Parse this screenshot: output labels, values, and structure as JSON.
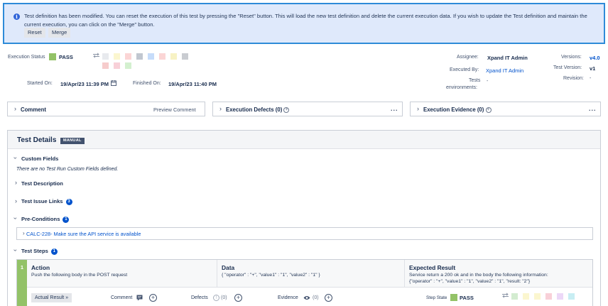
{
  "banner": {
    "message": "Test definition has been modified. You can reset the execution of this test by pressing the \"Reset\" button. This will load the new test definition and delete the current execution data. If you wish to update the Test definition and maintain the current execution, you can click on the \"Merge\" button.",
    "reset_label": "Reset",
    "merge_label": "Merge"
  },
  "execution": {
    "status_label": "Execution Status",
    "status_value": "PASS",
    "status_color": "#93c267",
    "started_label": "Started On:",
    "started_value": "19/Apr/23 11:39 PM",
    "finished_label": "Finished On:",
    "finished_value": "19/Apr/23 11:40 PM",
    "swatches_row1": [
      "#e8eaee",
      "#fbf6cf",
      "#fbd5d5",
      "#c1c7d0",
      "#c6dcfa",
      "#fbd5d5",
      "#f7f2c4",
      "#c9ccd1"
    ],
    "swatches_row2": [
      "#f6cccc",
      "#f8d0d8",
      "#d3f0cf"
    ]
  },
  "meta": {
    "assignee_label": "Assignee:",
    "assignee_value": "Xpand IT Admin",
    "executed_label": "Executed By:",
    "executed_value": "Xpand IT Admin",
    "envs_label_1": "Tests",
    "envs_label_2": "environments:",
    "envs_value": "-",
    "versions_label": "Versions:",
    "versions_value": "v4.0",
    "test_version_label": "Test Version:",
    "test_version_value": "v1",
    "revision_label": "Revision:",
    "revision_value": "-"
  },
  "panels": {
    "comment": "Comment",
    "preview_comment": "Preview Comment",
    "defects": "Execution Defects (0)",
    "evidence": "Execution Evidence (0)",
    "more": "..."
  },
  "details": {
    "title": "Test Details",
    "badge": "MANUAL",
    "custom_fields": "Custom Fields",
    "custom_empty": "There are no Test Run Custom Fields defined.",
    "description": "Test Description",
    "issue_links": "Test Issue Links",
    "issue_links_count": "3",
    "preconditions": "Pre-Conditions",
    "preconditions_count": "1",
    "precondition_item": "CALC-228- Make sure the API service is available",
    "steps": "Test Steps",
    "steps_count": "1"
  },
  "step": {
    "number": "1",
    "action_header": "Action",
    "action_text": "Push the following body in the POST request",
    "data_header": "Data",
    "data_text": "{ \"operator\" : \"+\", \"value1\" : \"1\", \"value2\" : \"1\" }",
    "result_header": "Expected Result",
    "result_text_1": "Service return a 200 ok and in the body the following information:",
    "result_text_2": "{\"operator\" : \"+\", \"value1\" : \"1\", \"value2\" : \"1\", \"result: \"2\"}",
    "actual_result_label": "Actual Result",
    "comment_label": "Comment",
    "defects_label": "Defects",
    "defects_count": "(0)",
    "evidence_label": "Evidence",
    "evidence_count": "(0)",
    "step_state_label": "Step State",
    "step_state_value": "PASS",
    "swatches": [
      "#d3ecd0",
      "#fbf6cf",
      "#fbf6cf",
      "#f8d0d8",
      "#ecd8f7",
      "#c8eef3"
    ]
  }
}
